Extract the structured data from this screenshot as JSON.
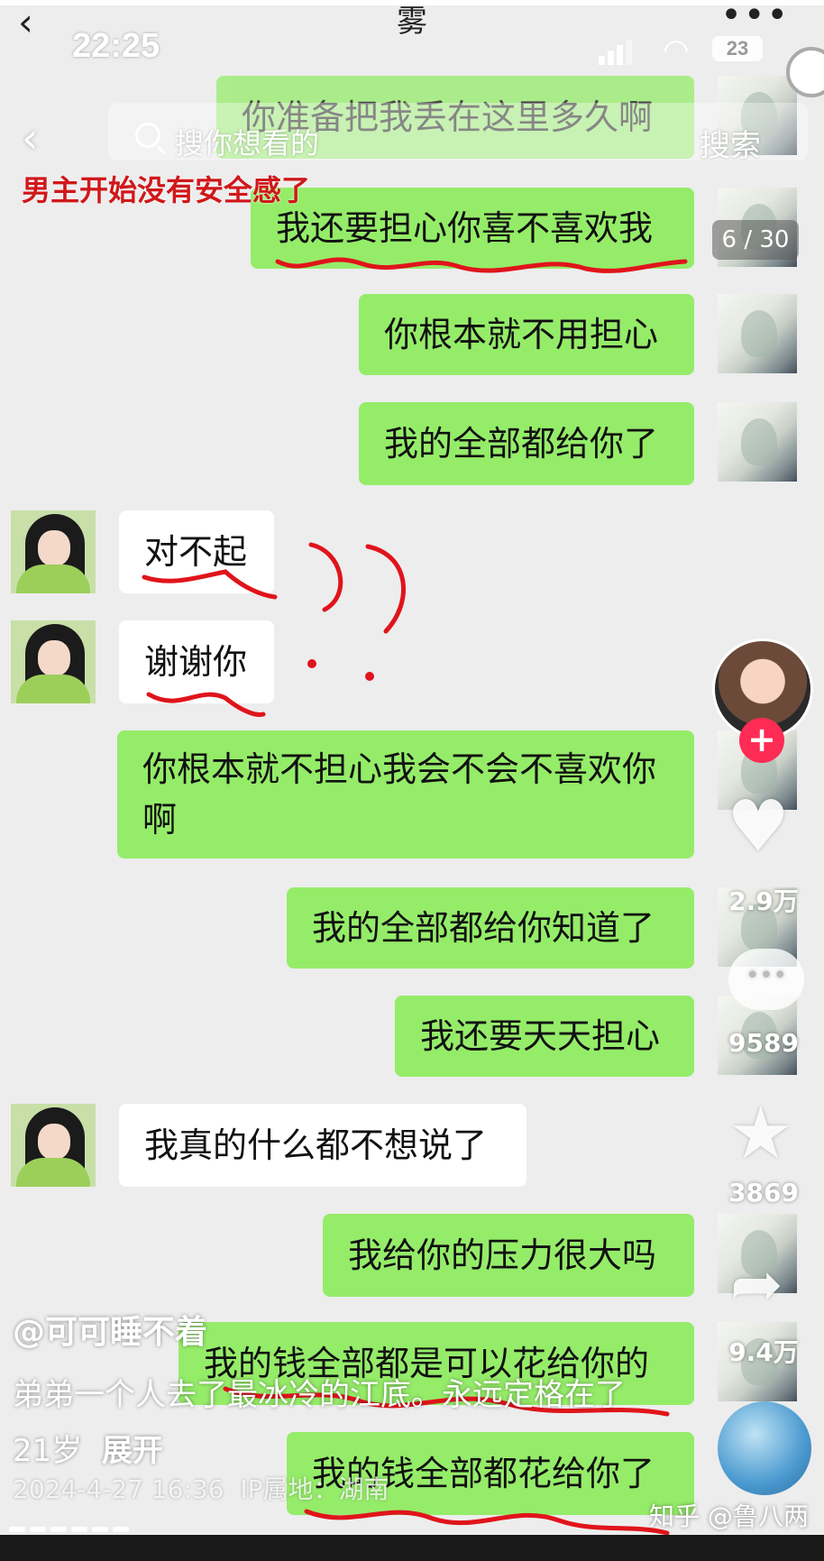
{
  "status_bar": {
    "time": "22:25",
    "battery": "23"
  },
  "chat": {
    "title": "雾"
  },
  "search": {
    "placeholder": "搜你想看的",
    "button_label": "搜索"
  },
  "caption": "男主开始没有安全感了",
  "page_indicator": "6 / 30",
  "messages": [
    {
      "side": "me",
      "text": "你准备把我丢在这里多久啊"
    },
    {
      "side": "me",
      "text": "我还要担心你喜不喜欢我"
    },
    {
      "side": "me",
      "text": "你根本就不用担心"
    },
    {
      "side": "me",
      "text": "我的全部都给你了"
    },
    {
      "side": "them",
      "text": "对不起"
    },
    {
      "side": "them",
      "text": "谢谢你"
    },
    {
      "side": "me",
      "text": "你根本就不担心我会不会不喜欢你啊"
    },
    {
      "side": "me",
      "text": "我的全部都给你知道了"
    },
    {
      "side": "me",
      "text": "我还要天天担心"
    },
    {
      "side": "them",
      "text": "我真的什么都不想说了"
    },
    {
      "side": "me",
      "text": "我给你的压力很大吗"
    },
    {
      "side": "me",
      "text": "我的钱全部都是可以花给你的"
    },
    {
      "side": "me",
      "text": "我的钱全部都花给你了"
    }
  ],
  "rail": {
    "likes": "2.9万",
    "comments": "9589",
    "favorites": "3869",
    "shares": "9.4万"
  },
  "video": {
    "author": "@可可睡不着",
    "description": "弟弟一个人去了最冰冷的江底。永远定格在了21岁",
    "expand": "展开",
    "date": "2024-4-27 16:36",
    "ip": "IP属地：湖南"
  },
  "watermark": "知乎 @鲁八两",
  "colors": {
    "bubble_me": "#95ec69",
    "bubble_them": "#ffffff",
    "caption_red": "#d0181a",
    "follow": "#fe2c55"
  }
}
